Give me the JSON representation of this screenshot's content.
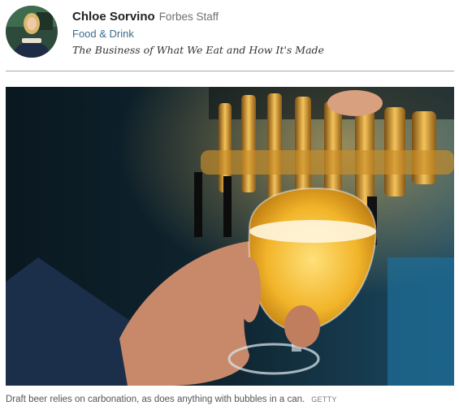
{
  "author": {
    "name": "Chloe Sorvino",
    "role": "Forbes Staff",
    "channel": "Food & Drink",
    "tagline": "The Business of What We Eat and How It's Made"
  },
  "image": {
    "caption": "Draft beer relies on carbonation, as does anything with bubbles in a can.",
    "credit": "GETTY"
  }
}
